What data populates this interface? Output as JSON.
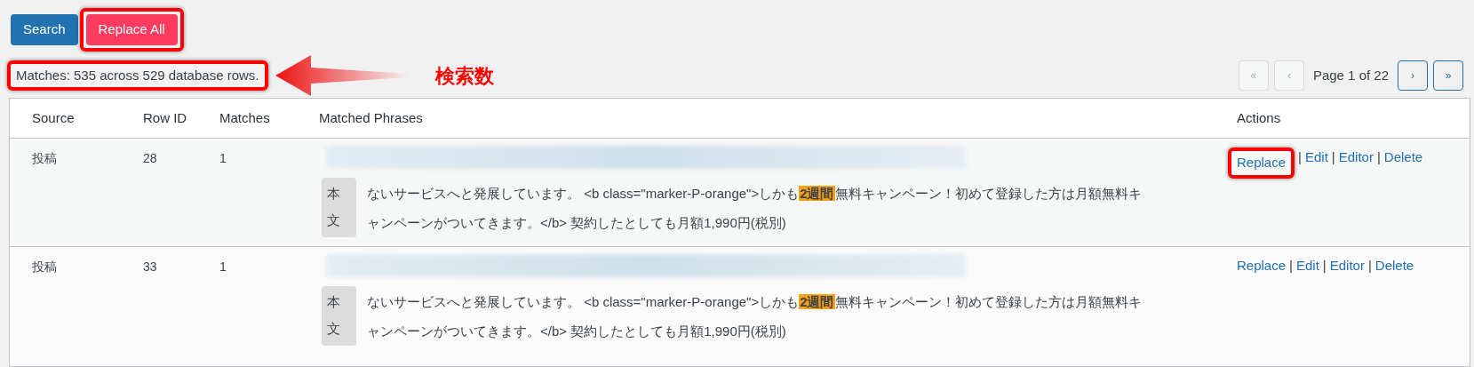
{
  "toolbar": {
    "buttons": [
      {
        "label": "Search",
        "kind": "primary",
        "framed": false
      },
      {
        "label": "Replace All",
        "kind": "danger",
        "framed": true
      }
    ]
  },
  "summary": {
    "text": "Matches: 535 across 529 database rows.",
    "framed": true
  },
  "annotation": {
    "label": "検索数"
  },
  "pagination": {
    "buttons": [
      {
        "label": "«",
        "disabled": true
      },
      {
        "label": "‹",
        "disabled": true
      },
      {
        "label": "›",
        "disabled": false
      },
      {
        "label": "»",
        "disabled": false
      }
    ],
    "page_label": "Page 1 of 22"
  },
  "table": {
    "columns": [
      "Source",
      "Row ID",
      "Matches",
      "Matched Phrases",
      "Actions"
    ],
    "rows": [
      {
        "source": "投稿",
        "row_id": "28",
        "separator": "|",
        "matches": "1",
        "field": "本文",
        "line_1_before": "ないサービスへと発展しています。 <b class=\"marker-P-orange\">しかも",
        "match": "2週間",
        "line_1_after": "無料キャンペーン！初めて登録した方は月額無料キ",
        "line_2": "ャンペーンがついてきます。</b> 契約したとしても月額1,990円(税別)",
        "actions": [
          {
            "label": "Replace",
            "framed": true
          },
          {
            "label": "Edit",
            "framed": false
          },
          {
            "label": "Editor",
            "framed": false
          },
          {
            "label": "Delete",
            "framed": false
          }
        ]
      },
      {
        "source": "投稿",
        "row_id": "33",
        "separator": "|",
        "matches": "1",
        "field": "本文",
        "line_1_before": "ないサービスへと発展しています。 <b class=\"marker-P-orange\">しかも",
        "match": "2週間",
        "line_1_after": "無料キャンペーン！初めて登録した方は月額無料キ",
        "line_2": "ャンペーンがついてきます。</b> 契約したとしても月額1,990円(税別)",
        "actions": [
          {
            "label": "Replace",
            "framed": false
          },
          {
            "label": "Edit",
            "framed": false
          },
          {
            "label": "Editor",
            "framed": false
          },
          {
            "label": "Delete",
            "framed": false
          }
        ]
      }
    ]
  }
}
